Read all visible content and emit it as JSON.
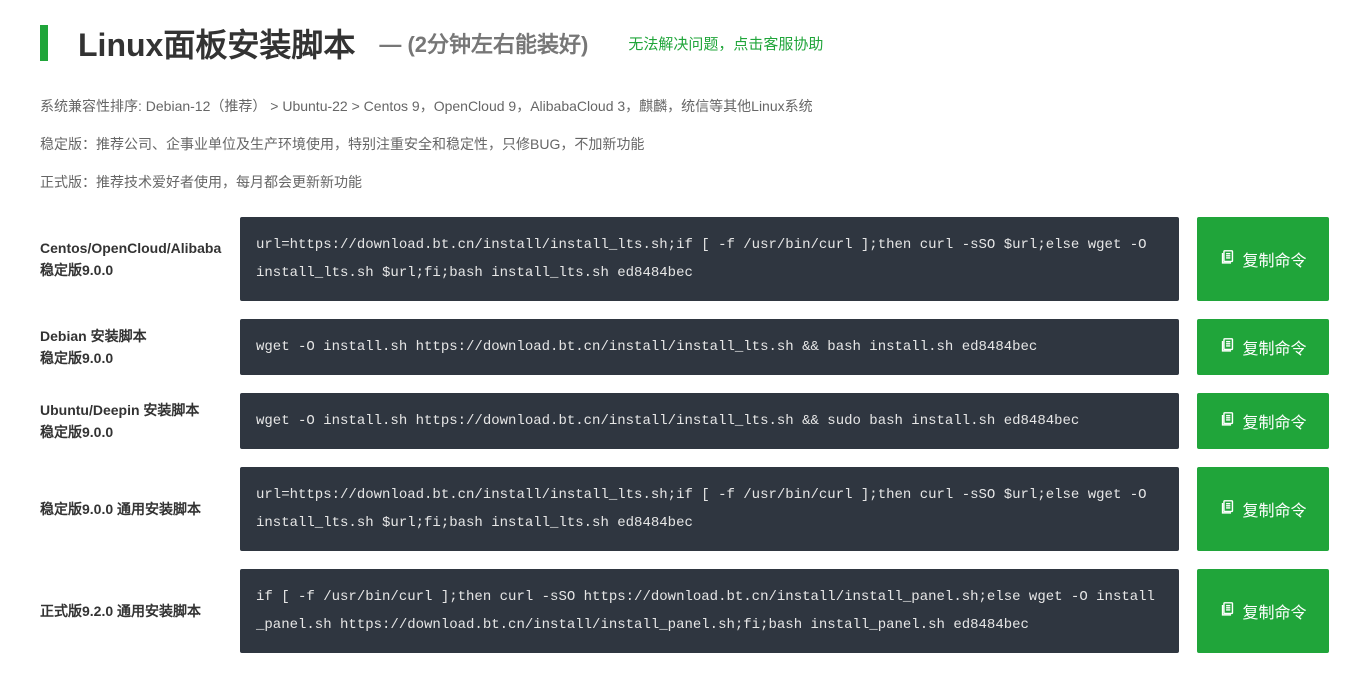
{
  "header": {
    "title": "Linux面板安装脚本",
    "subtitle": "— (2分钟左右能装好)",
    "help_link": "无法解决问题，点击客服协助"
  },
  "info": {
    "compat": "系统兼容性排序: Debian-12（推荐）  > Ubuntu-22  > Centos 9，OpenCloud 9，AlibabaCloud 3，麒麟，统信等其他Linux系统",
    "stable": "稳定版：推荐公司、企事业单位及生产环境使用，特别注重安全和稳定性，只修BUG，不加新功能",
    "release": "正式版：推荐技术爱好者使用，每月都会更新新功能"
  },
  "copy_label": "复制命令",
  "rows": [
    {
      "label_line1": "Centos/OpenCloud/Alibaba",
      "label_line2": "稳定版9.0.0",
      "code": "url=https://download.bt.cn/install/install_lts.sh;if [ -f /usr/bin/curl ];then curl -sSO $url;else wget -O install_lts.sh $url;fi;bash install_lts.sh ed8484bec"
    },
    {
      "label_line1": "Debian 安装脚本",
      "label_line2": "稳定版9.0.0",
      "code": "wget -O install.sh https://download.bt.cn/install/install_lts.sh && bash install.sh ed8484bec"
    },
    {
      "label_line1": "Ubuntu/Deepin 安装脚本",
      "label_line2": "稳定版9.0.0",
      "code": "wget -O install.sh https://download.bt.cn/install/install_lts.sh && sudo bash install.sh ed8484bec"
    },
    {
      "label_line1": "稳定版9.0.0 通用安装脚本",
      "label_line2": "",
      "code": "url=https://download.bt.cn/install/install_lts.sh;if [ -f /usr/bin/curl ];then curl -sSO $url;else wget -O install_lts.sh $url;fi;bash install_lts.sh ed8484bec"
    },
    {
      "label_line1": "正式版9.2.0 通用安装脚本",
      "label_line2": "",
      "code": "if [ -f /usr/bin/curl ];then curl -sSO https://download.bt.cn/install/install_panel.sh;else wget -O install_panel.sh https://download.bt.cn/install/install_panel.sh;fi;bash install_panel.sh ed8484bec"
    }
  ]
}
